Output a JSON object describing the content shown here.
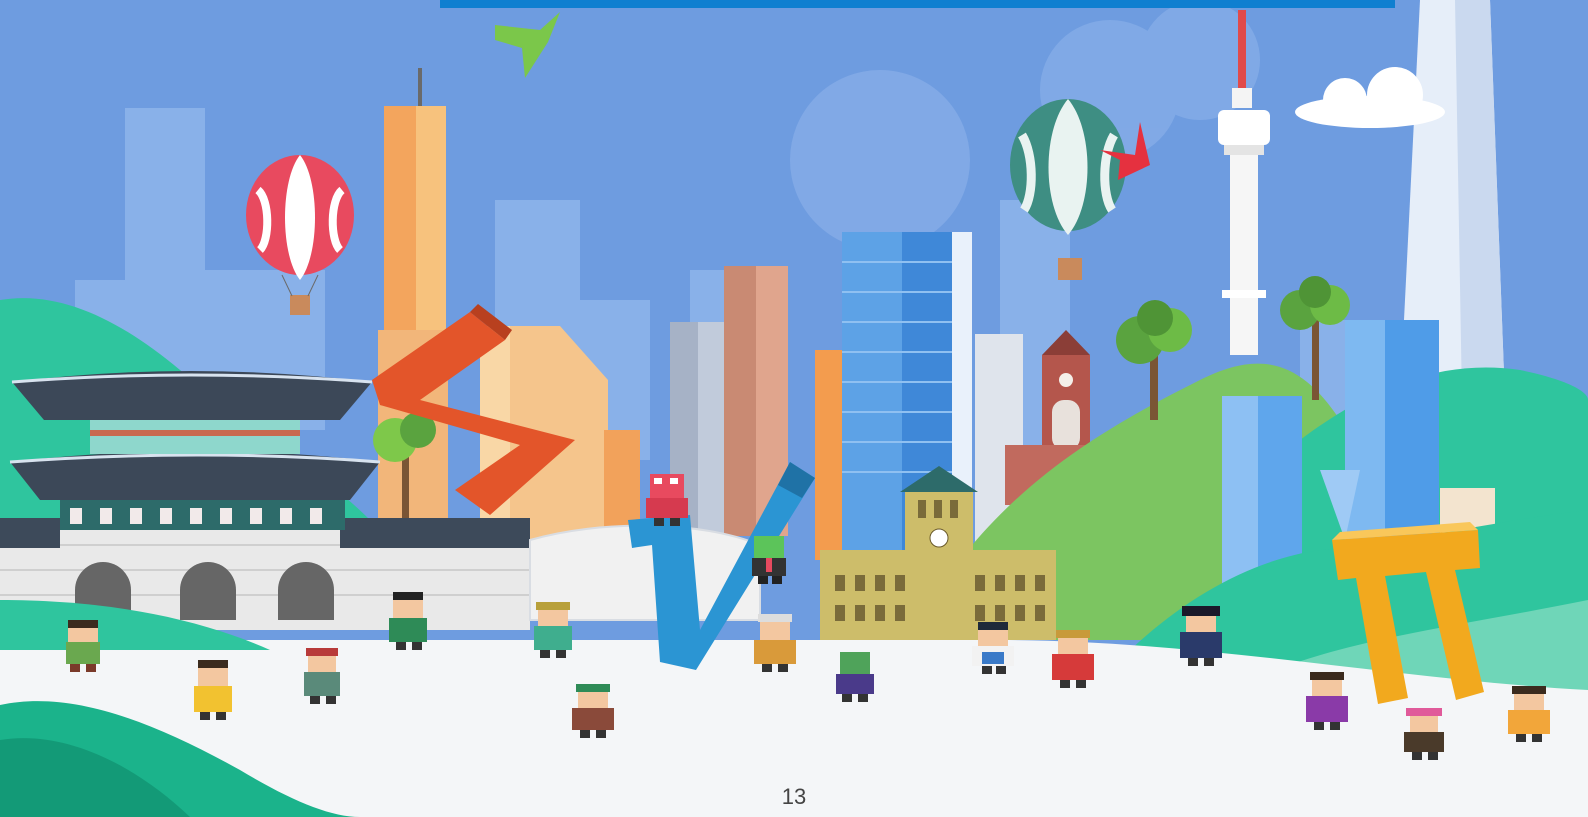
{
  "slide": {
    "page_number": "13"
  },
  "colors": {
    "sky": "#6e9ce0",
    "top_bar": "#0f7fd0",
    "ground": "#f4f6f8",
    "hill_green": "#2fc59e",
    "hill_light": "#7cc561",
    "letter_s": "#e3552a",
    "letter_v": "#2b95d3",
    "letter_pi": "#f2a91e"
  },
  "illustration": {
    "icons": [
      "bird-icon",
      "hot-air-balloon-icon",
      "palace-gate-icon",
      "tower-icon",
      "cathedral-icon",
      "city-hall-icon",
      "pixel-character-icon"
    ]
  }
}
